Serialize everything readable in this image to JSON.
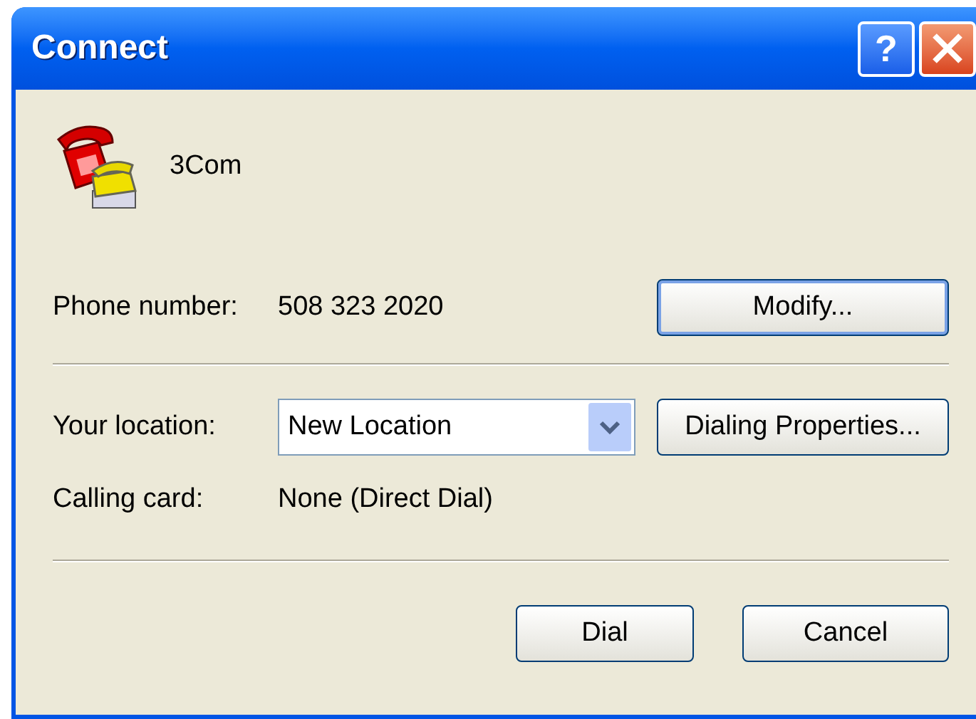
{
  "window": {
    "title": "Connect",
    "help_button": "?"
  },
  "connection": {
    "name": "3Com"
  },
  "phone": {
    "label": "Phone number:",
    "value": "508 323 2020",
    "button": "Modify..."
  },
  "location": {
    "label": "Your location:",
    "value": "New Location",
    "button": "Dialing Properties..."
  },
  "calling_card": {
    "label": "Calling card:",
    "value": "None (Direct Dial)"
  },
  "buttons": [
    {
      "label": "Dial",
      "default": false
    },
    {
      "label": "Cancel",
      "default": false
    }
  ],
  "modify_default": true
}
